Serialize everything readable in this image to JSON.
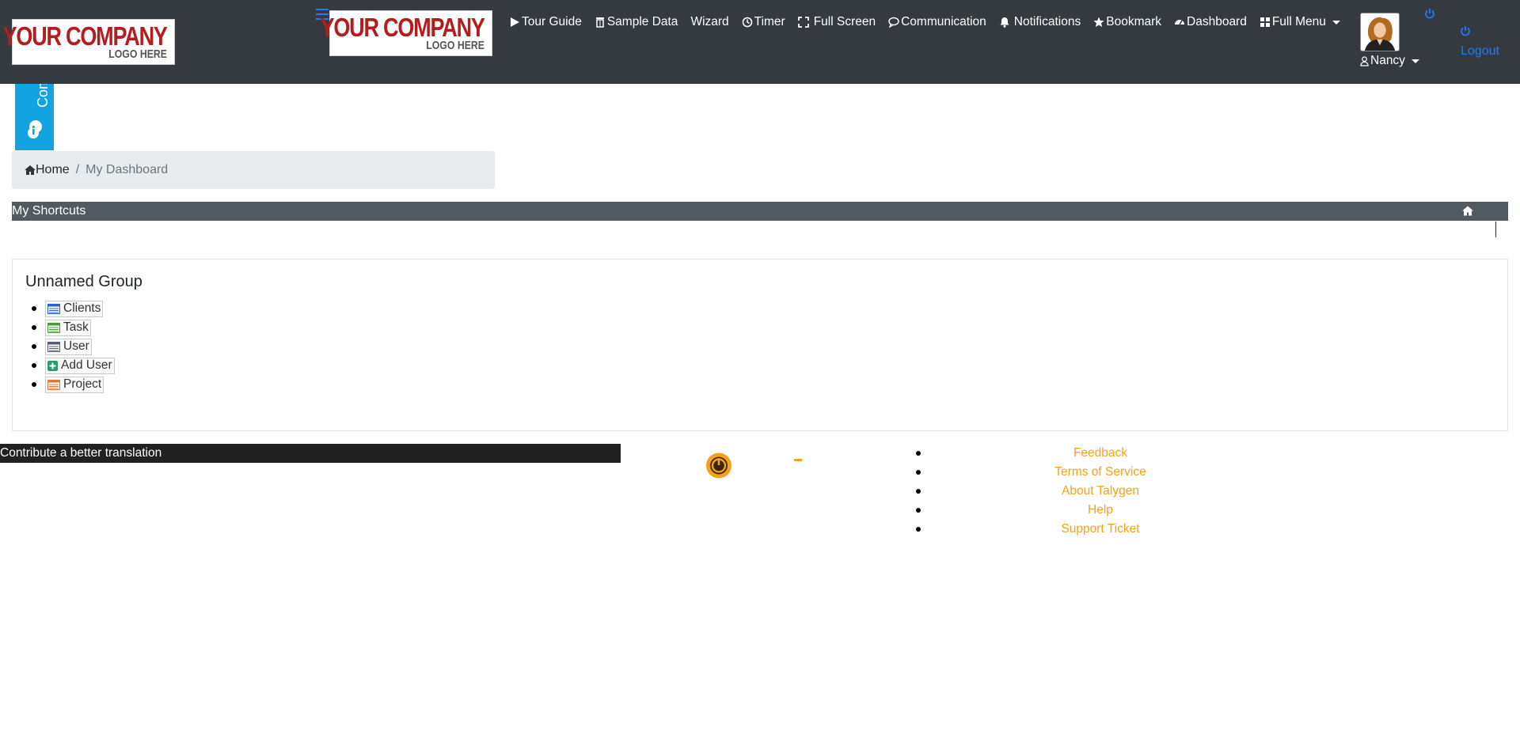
{
  "header": {
    "logo_left": {
      "main": "YOUR COMPANY",
      "sub": "LOGO HERE"
    },
    "logo_center": {
      "main": "YOUR COMPANY",
      "sub": "LOGO HERE"
    },
    "nav": [
      {
        "label": "Tour Guide",
        "icon": "play-icon"
      },
      {
        "label": "Sample Data",
        "icon": "trash-icon"
      },
      {
        "label": "Wizard",
        "icon": ""
      },
      {
        "label": "Timer",
        "icon": "clock-icon"
      },
      {
        "label": "Full Screen",
        "icon": "expand-icon"
      },
      {
        "label": "Communication",
        "icon": "chat-icon"
      },
      {
        "label": "Notifications",
        "icon": "bell-icon"
      },
      {
        "label": "Bookmark",
        "icon": "star-icon"
      },
      {
        "label": "Dashboard",
        "icon": "dashboard-icon"
      },
      {
        "label": "Full Menu",
        "icon": "grid-icon"
      }
    ],
    "user_name": "Nancy",
    "logout_label": "Logout"
  },
  "side_tab": {
    "label": "Communication"
  },
  "breadcrumb": {
    "home": "Home",
    "separator": "/",
    "current": "My Dashboard"
  },
  "shortcuts": {
    "title": "My Shortcuts"
  },
  "group": {
    "title": "Unnamed Group",
    "items": [
      {
        "label": "Clients",
        "icon": "table-blue-icon"
      },
      {
        "label": "Task",
        "icon": "table-green-icon"
      },
      {
        "label": "User",
        "icon": "table-gray-icon"
      },
      {
        "label": "Add User",
        "icon": "plus-box-icon"
      },
      {
        "label": "Project",
        "icon": "table-orange-icon"
      }
    ]
  },
  "footer": {
    "translate_label": "Contribute a better translation",
    "dash": "-",
    "links": [
      "Feedback",
      "Terms of Service",
      "About Talygen",
      "Help",
      "Support Ticket"
    ]
  },
  "colors": {
    "navbar": "#343a40",
    "accent_blue": "#1e7bff",
    "comm_tab": "#13a3e0",
    "footer_link": "#f5a11c",
    "shortcuts_bar": "#515a60"
  }
}
